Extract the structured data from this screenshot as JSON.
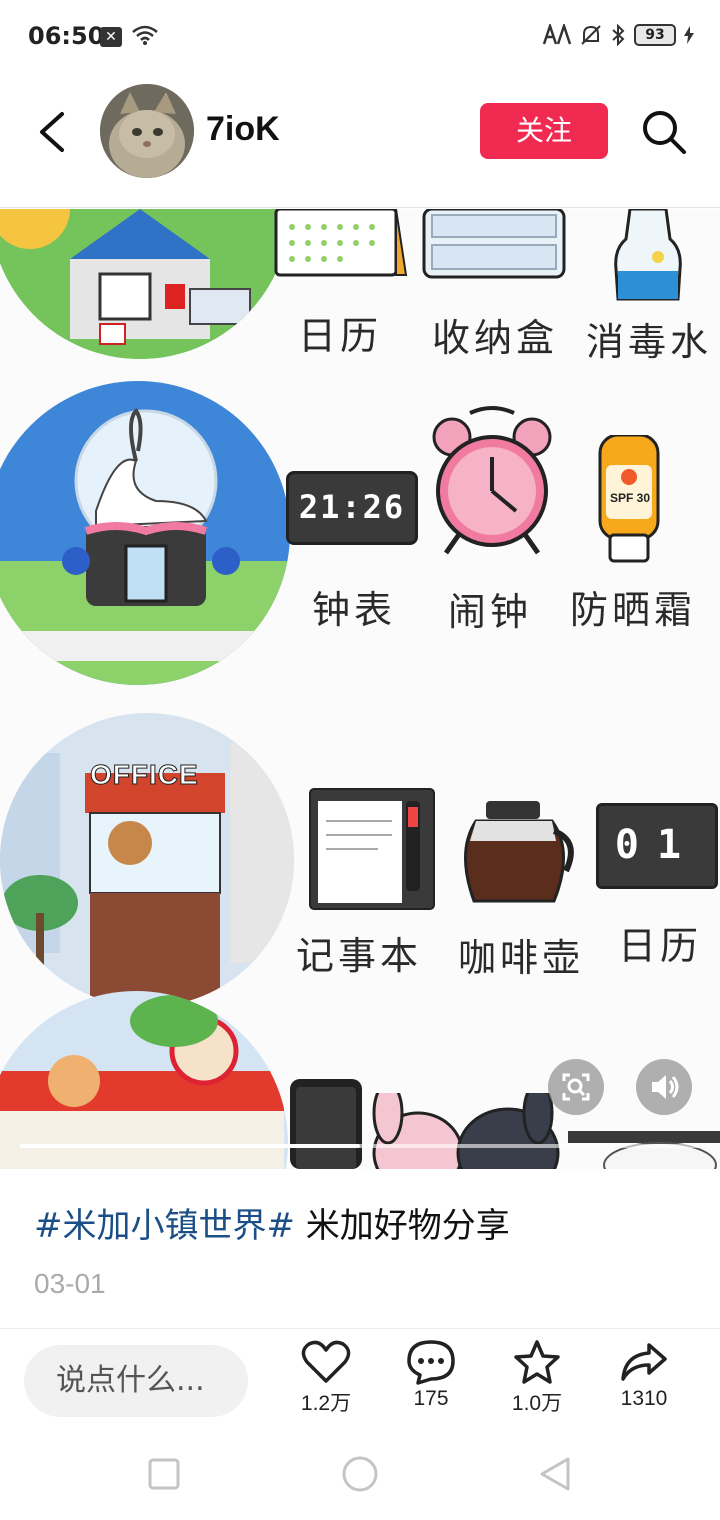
{
  "status_bar": {
    "time": "06:50",
    "battery": "93"
  },
  "header": {
    "username": "7ioK",
    "follow_label": "关注"
  },
  "content": {
    "row1_labels": [
      "日历",
      "收纳盒",
      "消毒水"
    ],
    "row2_labels": [
      "钟表",
      "闹钟",
      "防晒霜"
    ],
    "row3_labels": [
      "记事本",
      "咖啡壶",
      "日历"
    ],
    "clock_display": "21:26",
    "office_sign": "OFFICE",
    "sunscreen_text": "SPF 30",
    "flip_calendar": "01",
    "video_progress": 0.5
  },
  "post": {
    "hashtag": "#米加小镇世界#",
    "caption_text": " 米加好物分享",
    "date": "03-01"
  },
  "actions": {
    "comment_placeholder": "说点什么...",
    "likes": "1.2万",
    "comments": "175",
    "favorites": "1.0万",
    "shares": "1310"
  },
  "colors": {
    "follow": "#f02a50",
    "hashtag": "#1b4f86"
  }
}
